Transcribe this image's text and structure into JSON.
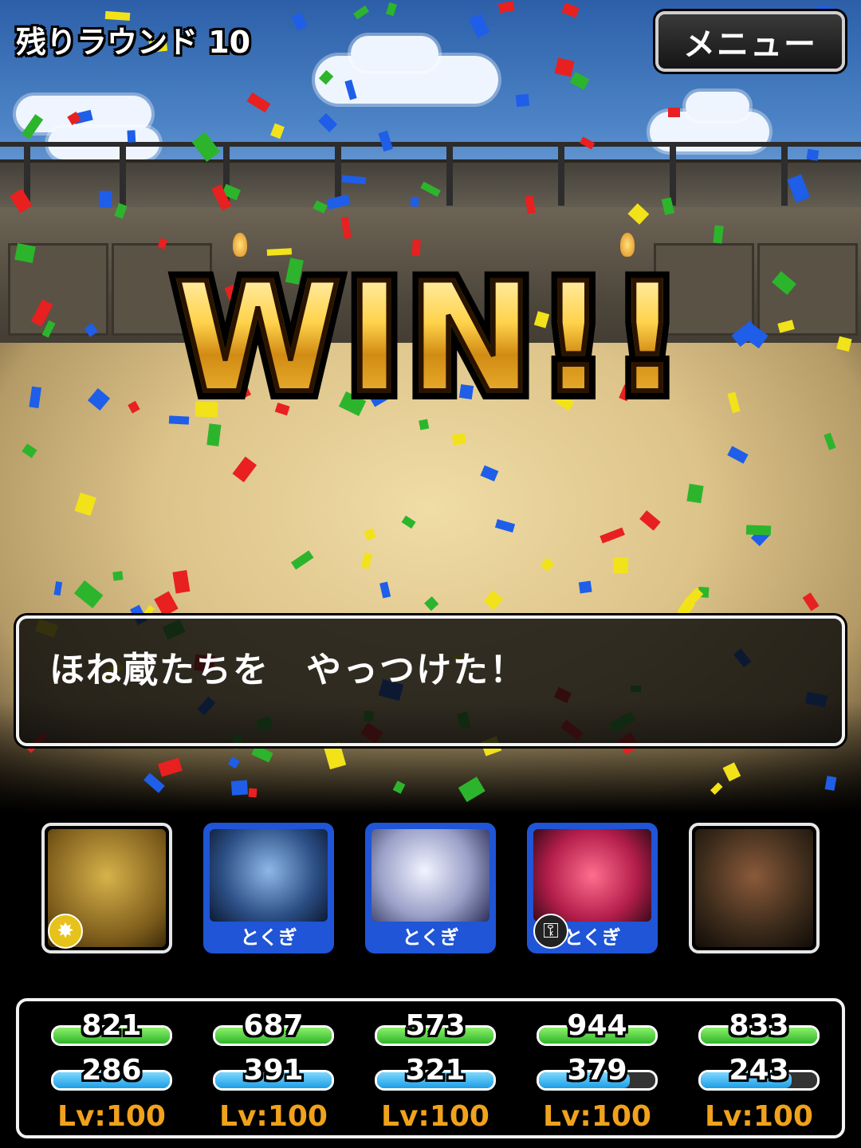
{
  "hud": {
    "round_label": "残りラウンド 10",
    "menu_label": "メニュー"
  },
  "banner": {
    "text": "WIN!!"
  },
  "message": {
    "text": "ほね蔵たちを　やっつけた！"
  },
  "party": [
    {
      "name": "golden-statue-monster",
      "tag": "",
      "badge": "burst-icon",
      "frame": "white",
      "hp": 821,
      "mp": 286,
      "hp_fill": 1.0,
      "mp_fill": 1.0,
      "level": "Lv:100"
    },
    {
      "name": "blue-skinned-demon",
      "tag": "とくぎ",
      "badge": "",
      "frame": "blue",
      "hp": 687,
      "mp": 391,
      "hp_fill": 1.0,
      "mp_fill": 1.0,
      "level": "Lv:100"
    },
    {
      "name": "silver-dragon",
      "tag": "とくぎ",
      "badge": "",
      "frame": "blue",
      "hp": 573,
      "mp": 321,
      "hp_fill": 1.0,
      "mp_fill": 1.0,
      "level": "Lv:100"
    },
    {
      "name": "pink-fanged-beast",
      "tag": "とくぎ",
      "badge": "key-icon",
      "frame": "blue",
      "hp": 944,
      "mp": 379,
      "hp_fill": 1.0,
      "mp_fill": 0.78,
      "level": "Lv:100"
    },
    {
      "name": "armored-warrior",
      "tag": "",
      "badge": "",
      "frame": "white",
      "hp": 833,
      "mp": 243,
      "hp_fill": 1.0,
      "mp_fill": 0.78,
      "level": "Lv:100"
    }
  ],
  "colors": {
    "hp_bar": "#2fb52a",
    "mp_bar": "#1d9ee6",
    "level_text": "#f0a21c",
    "skill_frame": "#1f55d6",
    "confetti": [
      "#e82020",
      "#1e5ee8",
      "#2cb52c",
      "#f2e21a"
    ]
  }
}
